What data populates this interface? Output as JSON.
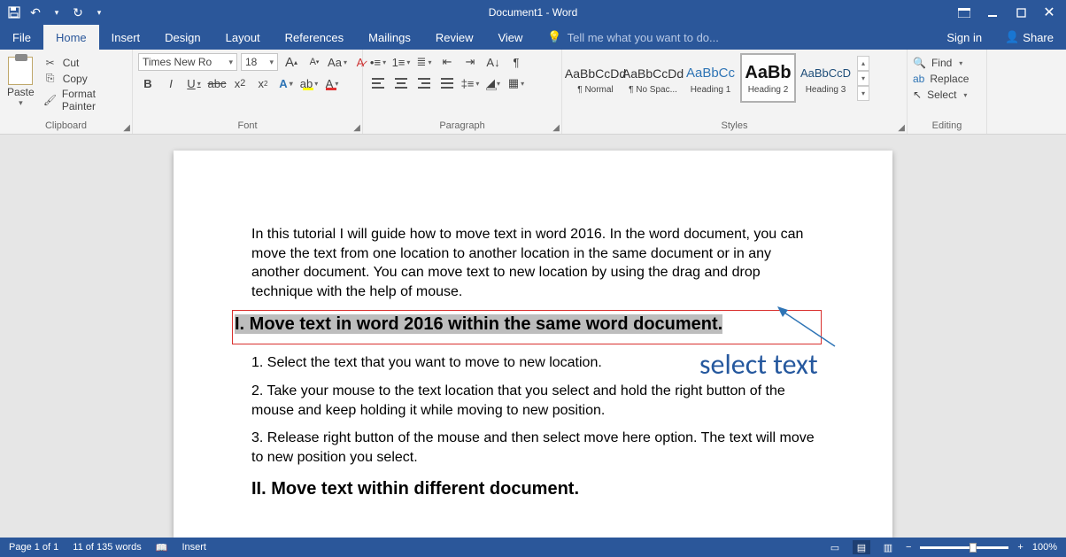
{
  "title": "Document1 - Word",
  "tabs": [
    "File",
    "Home",
    "Insert",
    "Design",
    "Layout",
    "References",
    "Mailings",
    "Review",
    "View"
  ],
  "tellme": "Tell me what you want to do...",
  "signin": "Sign in",
  "share": "Share",
  "clipboard": {
    "cut": "Cut",
    "copy": "Copy",
    "fmt": "Format Painter",
    "paste": "Paste",
    "title": "Clipboard"
  },
  "font": {
    "name": "Times New Ro",
    "size": "18",
    "title": "Font"
  },
  "paragraph": {
    "title": "Paragraph"
  },
  "styles": {
    "title": "Styles",
    "items": [
      {
        "preview": "AaBbCcDd",
        "label": "¶ Normal",
        "cls": ""
      },
      {
        "preview": "AaBbCcDd",
        "label": "¶ No Spac...",
        "cls": ""
      },
      {
        "preview": "AaBbCc",
        "label": "Heading 1",
        "cls": "hd1"
      },
      {
        "preview": "AaBb",
        "label": "Heading 2",
        "cls": "hd2"
      },
      {
        "preview": "AaBbCcD",
        "label": "Heading 3",
        "cls": "hd3"
      }
    ],
    "selected": 3
  },
  "editing": {
    "find": "Find",
    "replace": "Replace",
    "select": "Select",
    "title": "Editing"
  },
  "doc": {
    "p1": "In this tutorial I will guide how to move text in word 2016. In the word document, you can move the text from one location to another location in the same document or in any another document. You can move text to new location by using the drag and drop technique with the help of mouse.",
    "h1": "I. Move text in word 2016 within the same word document.",
    "p2": "1. Select the text that you want to move to new location.",
    "p3": "2. Take your mouse to the text location that you select and hold the right button of the mouse and keep holding it while moving to new position.",
    "p4": "3. Release right button of the mouse and then select move here option. The text will move to new position you select.",
    "h2": "II. Move text within different document."
  },
  "annotation": "select text",
  "status": {
    "page": "Page 1 of 1",
    "words": "11 of 135 words",
    "insert": "Insert",
    "zoom": "100%"
  }
}
